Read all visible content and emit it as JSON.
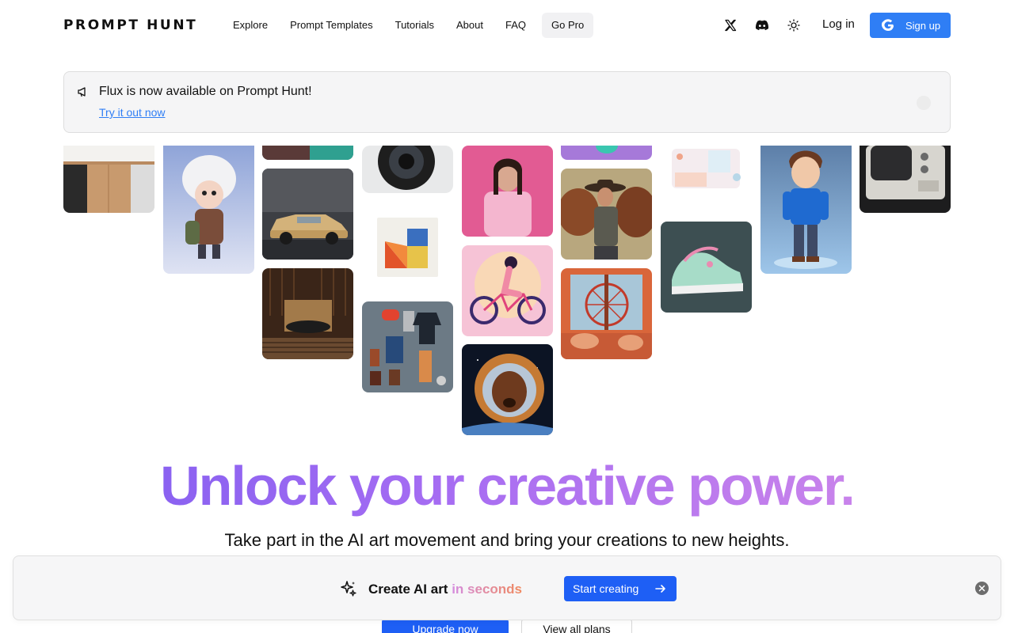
{
  "header": {
    "logo": "PROMPT HUNT",
    "nav": [
      {
        "label": "Explore"
      },
      {
        "label": "Prompt Templates"
      },
      {
        "label": "Tutorials"
      },
      {
        "label": "About"
      },
      {
        "label": "FAQ"
      },
      {
        "label": "Go Pro"
      }
    ],
    "icons": [
      "x-twitter-icon",
      "discord-icon",
      "sun-icon"
    ],
    "login_label": "Log in",
    "signup_label": "Sign up"
  },
  "banner": {
    "icon": "megaphone-icon",
    "text": "Flux is now available on Prompt Hunt!",
    "link": "Try it out now"
  },
  "gallery": {
    "tiles": [
      "kitchen",
      "cute-character",
      "partial-image",
      "vintage-car",
      "record-player",
      "camera",
      "abstract-shapes",
      "clothing-flatlay",
      "woman-pink",
      "cyclist-illustration",
      "astronaut-dog",
      "partial-image",
      "cowboy-cattle",
      "ferris-wheel-room",
      "pastel-bedroom",
      "sneakers",
      "cartoon-boy",
      "retro-tv"
    ]
  },
  "hero": {
    "title": "Unlock your creative power.",
    "subtitle": "Take part in the AI art movement and bring your creations to new heights.",
    "upgrade_label": "Upgrade now",
    "plans_label": "View all plans"
  },
  "promo": {
    "icon": "sparkles-icon",
    "text_main": "Create AI art",
    "text_highlight": "in seconds",
    "button_label": "Start creating"
  },
  "colors": {
    "accent": "#2f7ef5",
    "primary_button": "#1e5ff5",
    "hero_gradient_start": "#7b5cf0",
    "hero_gradient_end": "#d68ce8"
  }
}
